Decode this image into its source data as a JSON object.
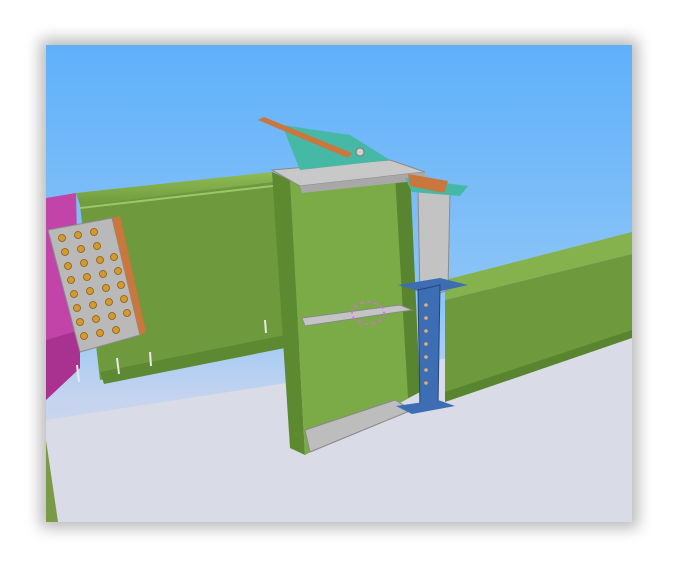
{
  "scene": {
    "view": "3d-model-viewport",
    "objects": [
      "sky-background",
      "ground-plane",
      "magenta-member",
      "end-plate",
      "main-green-beam",
      "vertical-column",
      "top-cap-plate",
      "stiffener-plates",
      "right-green-beam",
      "blue-connection-clip",
      "orange-angle-members",
      "teal-plate",
      "pink-dashed-marker"
    ],
    "colors": {
      "sky": "#65b2fb",
      "ground": "#d9dbe6",
      "beam_green": "#6e9a3d",
      "beam_green_light": "#86b24d",
      "column_green": "#7bab46",
      "plate_grey": "#b9b9b9",
      "magenta": "#c244a8",
      "bolt_orange": "#d49a2e",
      "blue_clip": "#3d6db3",
      "angle_orange": "#c9773d",
      "teal": "#46b8a6",
      "marker_pink": "#d36ed6"
    }
  }
}
